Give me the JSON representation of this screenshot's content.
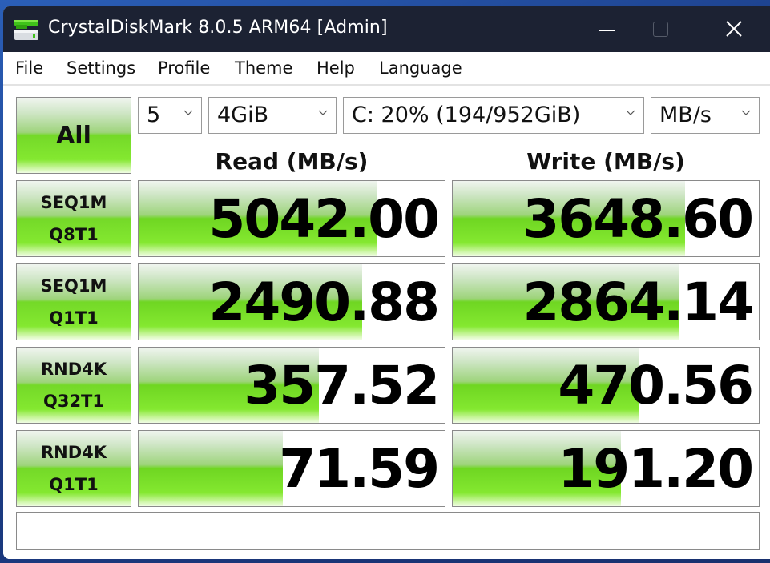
{
  "window": {
    "title": "CrystalDiskMark 8.0.5 ARM64 [Admin]",
    "icon": "disk-drive-icon",
    "controls": [
      "minimize-icon",
      "maximize-icon",
      "close-icon"
    ]
  },
  "menu": [
    "File",
    "Settings",
    "Profile",
    "Theme",
    "Help",
    "Language"
  ],
  "toolbar": {
    "all_label": "All",
    "count": "5",
    "size": "4GiB",
    "drive": "C: 20% (194/952GiB)",
    "unit": "MB/s"
  },
  "headers": {
    "read": "Read (MB/s)",
    "write": "Write (MB/s)"
  },
  "tests": [
    {
      "line1": "SEQ1M",
      "line2": "Q8T1",
      "read": "5042.00",
      "write": "3648.60",
      "read_fill": 0.78,
      "write_fill": 0.76
    },
    {
      "line1": "SEQ1M",
      "line2": "Q1T1",
      "read": "2490.88",
      "write": "2864.14",
      "read_fill": 0.73,
      "write_fill": 0.74
    },
    {
      "line1": "RND4K",
      "line2": "Q32T1",
      "read": "357.52",
      "write": "470.56",
      "read_fill": 0.59,
      "write_fill": 0.61
    },
    {
      "line1": "RND4K",
      "line2": "Q1T1",
      "read": "71.59",
      "write": "191.20",
      "read_fill": 0.47,
      "write_fill": 0.55
    }
  ],
  "comment": ""
}
